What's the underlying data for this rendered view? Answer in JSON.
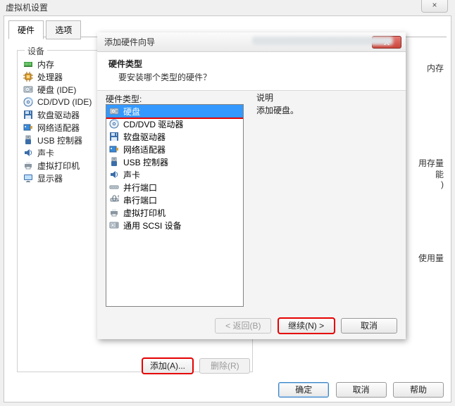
{
  "outer": {
    "title": "虚拟机设置",
    "close_glyph": "×",
    "tabs": {
      "hardware": "硬件",
      "options": "选项"
    },
    "device_header": "设备",
    "devices": [
      {
        "name": "memory",
        "label": "内存"
      },
      {
        "name": "cpu",
        "label": "处理器"
      },
      {
        "name": "hdd",
        "label": "硬盘 (IDE)"
      },
      {
        "name": "cddvd",
        "label": "CD/DVD (IDE)"
      },
      {
        "name": "floppy",
        "label": "软盘驱动器"
      },
      {
        "name": "nic",
        "label": "网络适配器"
      },
      {
        "name": "usb",
        "label": "USB 控制器"
      },
      {
        "name": "sound",
        "label": "声卡"
      },
      {
        "name": "vprinter",
        "label": "虚拟打印机"
      },
      {
        "name": "display",
        "label": "显示器"
      }
    ],
    "right_peek": {
      "memory": "内存",
      "storage": "用存量",
      "perf": "能",
      "close_paren": ")",
      "usage": "使用量"
    },
    "add_label": "添加(A)...",
    "remove_label": "删除(R)",
    "ok": "确定",
    "cancel": "取消",
    "help": "帮助"
  },
  "wizard": {
    "title": "添加硬件向导",
    "close_glyph": "X",
    "header_title": "硬件类型",
    "header_sub": "要安装哪个类型的硬件？",
    "list_label": "硬件类型:",
    "desc_label": "说明",
    "desc_text": "添加硬盘。",
    "items": [
      {
        "name": "hdd",
        "label": "硬盘"
      },
      {
        "name": "cddvd",
        "label": "CD/DVD 驱动器"
      },
      {
        "name": "floppy",
        "label": "软盘驱动器"
      },
      {
        "name": "nic",
        "label": "网络适配器"
      },
      {
        "name": "usb",
        "label": "USB 控制器"
      },
      {
        "name": "sound",
        "label": "声卡"
      },
      {
        "name": "parallel",
        "label": "并行端口"
      },
      {
        "name": "serial",
        "label": "串行端口"
      },
      {
        "name": "vprinter",
        "label": "虚拟打印机"
      },
      {
        "name": "scsi",
        "label": "通用 SCSI 设备"
      }
    ],
    "back": "< 返回(B)",
    "next": "继续(N) >",
    "cancel": "取消"
  },
  "colors": {
    "accent": "#3399ff",
    "highlight": "#e60000"
  }
}
